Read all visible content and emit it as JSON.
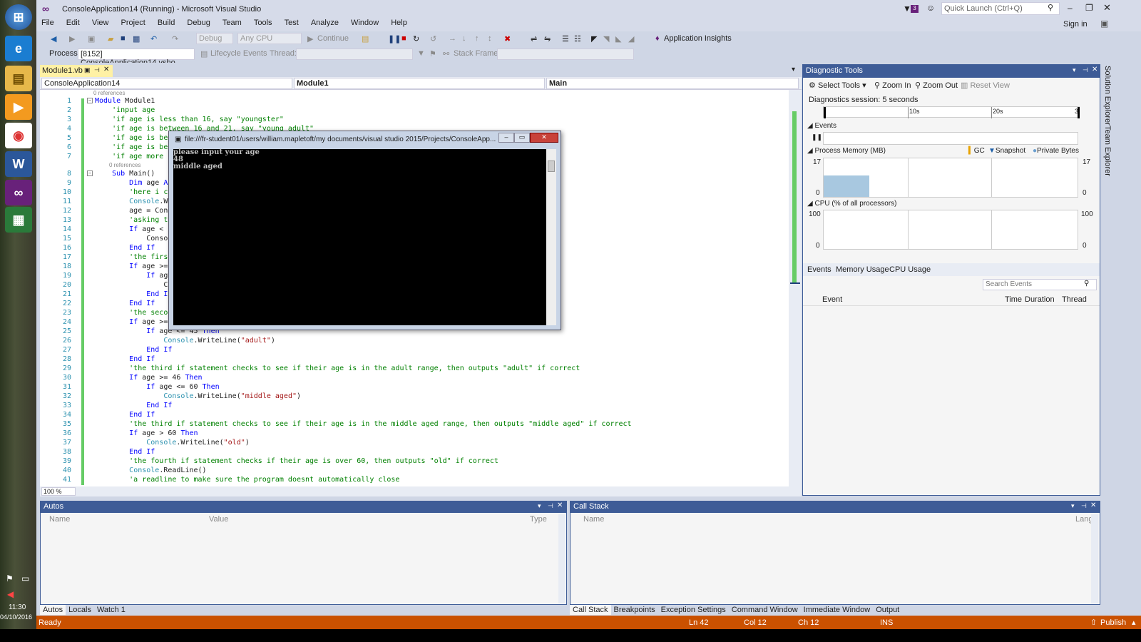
{
  "taskbar": {
    "clock_time": "11:30",
    "clock_date": "04/10/2016"
  },
  "window": {
    "title": "ConsoleApplication14 (Running) - Microsoft Visual Studio",
    "notif_count": "3",
    "quick_launch": "Quick Launch (Ctrl+Q)",
    "sign_in": "Sign in"
  },
  "menu": [
    "File",
    "Edit",
    "View",
    "Project",
    "Build",
    "Debug",
    "Team",
    "Tools",
    "Test",
    "Analyze",
    "Window",
    "Help"
  ],
  "toolbar": {
    "config": "Debug",
    "platform": "Any CPU",
    "continue": "Continue",
    "app_insights": "Application Insights"
  },
  "toolbar2": {
    "process_label": "Process:",
    "process_value": "[8152] ConsoleApplication14.vsho",
    "lifecycle": "Lifecycle Events",
    "thread_label": "Thread:",
    "stack_frame_label": "Stack Frame:"
  },
  "editor": {
    "tab": "Module1.vb",
    "nav_project": "ConsoleApplication14",
    "nav_class": "Module1",
    "nav_member": "Main",
    "zoom": "100 %",
    "refs": "0 references",
    "lines": [
      {
        "n": "1",
        "t": "Module Module1"
      },
      {
        "n": "2",
        "t": "    'input age"
      },
      {
        "n": "3",
        "t": "    'if age is less than 16, say \"youngster\""
      },
      {
        "n": "4",
        "t": "    'if age is between 16 and 21, say \"young adult\""
      },
      {
        "n": "5",
        "t": "    'if age is bet"
      },
      {
        "n": "6",
        "t": "    'if age is bet"
      },
      {
        "n": "7",
        "t": "    'if age more t"
      },
      {
        "n": "8",
        "t": "    Sub Main()"
      },
      {
        "n": "9",
        "t": "        Dim age As"
      },
      {
        "n": "10",
        "t": "        'here i ca"
      },
      {
        "n": "11",
        "t": "        Console.Wr"
      },
      {
        "n": "12",
        "t": "        age = Cons"
      },
      {
        "n": "13",
        "t": "        'asking th"
      },
      {
        "n": "14",
        "t": "        If age < 1"
      },
      {
        "n": "15",
        "t": "            Consol"
      },
      {
        "n": "16",
        "t": "        End If"
      },
      {
        "n": "17",
        "t": "        'the first                                                                        rrect"
      },
      {
        "n": "18",
        "t": "        If age >="
      },
      {
        "n": "19",
        "t": "            If age"
      },
      {
        "n": "20",
        "t": "                Co"
      },
      {
        "n": "21",
        "t": "            End If"
      },
      {
        "n": "22",
        "t": "        End If"
      },
      {
        "n": "23",
        "t": "        'the secon                                                                               if correct"
      },
      {
        "n": "24",
        "t": "        If age >="
      },
      {
        "n": "25",
        "t": "            If age <= 45 Then"
      },
      {
        "n": "26",
        "t": "                Console.WriteLine(\"adult\")"
      },
      {
        "n": "27",
        "t": "            End If"
      },
      {
        "n": "28",
        "t": "        End If"
      },
      {
        "n": "29",
        "t": "        'the third if statement checks to see if their age is in the adult range, then outputs \"adult\" if correct"
      },
      {
        "n": "30",
        "t": "        If age >= 46 Then"
      },
      {
        "n": "31",
        "t": "            If age <= 60 Then"
      },
      {
        "n": "32",
        "t": "                Console.WriteLine(\"middle aged\")"
      },
      {
        "n": "33",
        "t": "            End If"
      },
      {
        "n": "34",
        "t": "        End If"
      },
      {
        "n": "35",
        "t": "        'the third if statement checks to see if their age is in the middle aged range, then outputs \"middle aged\" if correct"
      },
      {
        "n": "36",
        "t": "        If age > 60 Then"
      },
      {
        "n": "37",
        "t": "            Console.WriteLine(\"old\")"
      },
      {
        "n": "38",
        "t": "        End If"
      },
      {
        "n": "39",
        "t": "        'the fourth if statement checks if their age is over 60, then outputs \"old\" if correct"
      },
      {
        "n": "40",
        "t": "        Console.ReadLine()"
      },
      {
        "n": "41",
        "t": "        'a readline to make sure the program doesnt automatically close"
      }
    ]
  },
  "console": {
    "title": "file:///fr-student01/users/william.mapletoft/my documents/visual studio 2015/Projects/ConsoleApp...",
    "lines": [
      "please input your age",
      "48",
      "middle aged"
    ]
  },
  "diagnostics": {
    "title": "Diagnostic Tools",
    "select_tools": "Select Tools",
    "zoom_in": "Zoom In",
    "zoom_out": "Zoom Out",
    "reset_view": "Reset View",
    "session": "Diagnostics session: 5 seconds",
    "ticks": [
      "10s",
      "20s",
      "3"
    ],
    "events_label": "Events",
    "memory_label": "Process Memory (MB)",
    "gc": "GC",
    "snapshot": "Snapshot",
    "private_bytes": "Private Bytes",
    "mem_max": "17",
    "mem_min": "0",
    "cpu_label": "CPU (% of all processors)",
    "cpu_max": "100",
    "cpu_min": "0",
    "tabs": [
      "Events",
      "Memory Usage",
      "CPU Usage"
    ],
    "search": "Search Events",
    "cols": [
      "Event",
      "Time",
      "Duration",
      "Thread"
    ]
  },
  "side_tabs": [
    "Solution Explorer",
    "Team Explorer"
  ],
  "autos": {
    "title": "Autos",
    "cols": [
      "Name",
      "Value",
      "Type"
    ],
    "tabs": [
      "Autos",
      "Locals",
      "Watch 1"
    ]
  },
  "callstack": {
    "title": "Call Stack",
    "cols": [
      "Name",
      "Lang"
    ],
    "tabs": [
      "Call Stack",
      "Breakpoints",
      "Exception Settings",
      "Command Window",
      "Immediate Window",
      "Output"
    ]
  },
  "status": {
    "ready": "Ready",
    "ln": "Ln 42",
    "col": "Col 12",
    "ch": "Ch 12",
    "ins": "INS",
    "publish": "Publish"
  },
  "colors": {
    "accent": "#3e5c97",
    "status_bar": "#ca5100",
    "keyword": "#0000ff",
    "comment": "#008000",
    "string": "#a31515"
  },
  "memory_level": 0.55
}
